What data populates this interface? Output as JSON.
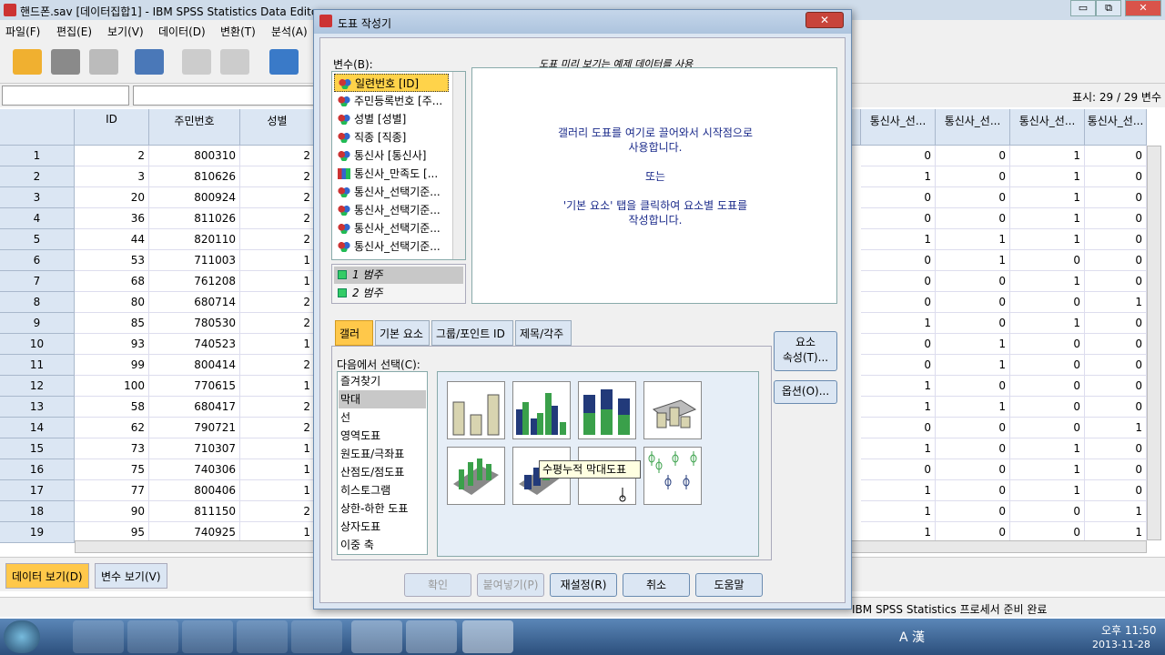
{
  "window": {
    "title": "핸드폰.sav [데이터집합1] - IBM SPSS Statistics Data Editor",
    "min": "▭",
    "restore": "⧉",
    "close": "✕"
  },
  "menu": [
    "파일(F)",
    "편집(E)",
    "보기(V)",
    "데이터(D)",
    "변환(T)",
    "분석(A)"
  ],
  "cellbar": {
    "show_count": "표시: 29 / 29 변수"
  },
  "grid": {
    "left_headers": [
      "ID",
      "주민번호",
      "성별"
    ],
    "right_headers": [
      "통신사_선...",
      "통신사_선...",
      "통신사_선...",
      "통신사_선..."
    ],
    "rows": [
      {
        "n": "1",
        "id": "2",
        "jumin": "800310",
        "sex": "2",
        "r": [
          "0",
          "0",
          "1",
          "0"
        ]
      },
      {
        "n": "2",
        "id": "3",
        "jumin": "810626",
        "sex": "2",
        "r": [
          "1",
          "0",
          "1",
          "0"
        ]
      },
      {
        "n": "3",
        "id": "20",
        "jumin": "800924",
        "sex": "2",
        "r": [
          "0",
          "0",
          "1",
          "0"
        ]
      },
      {
        "n": "4",
        "id": "36",
        "jumin": "811026",
        "sex": "2",
        "r": [
          "0",
          "0",
          "1",
          "0"
        ]
      },
      {
        "n": "5",
        "id": "44",
        "jumin": "820110",
        "sex": "2",
        "r": [
          "1",
          "1",
          "1",
          "0"
        ]
      },
      {
        "n": "6",
        "id": "53",
        "jumin": "711003",
        "sex": "1",
        "r": [
          "0",
          "1",
          "0",
          "0"
        ]
      },
      {
        "n": "7",
        "id": "68",
        "jumin": "761208",
        "sex": "1",
        "r": [
          "0",
          "0",
          "1",
          "0"
        ]
      },
      {
        "n": "8",
        "id": "80",
        "jumin": "680714",
        "sex": "2",
        "r": [
          "0",
          "0",
          "0",
          "1"
        ]
      },
      {
        "n": "9",
        "id": "85",
        "jumin": "780530",
        "sex": "2",
        "r": [
          "1",
          "0",
          "1",
          "0"
        ]
      },
      {
        "n": "10",
        "id": "93",
        "jumin": "740523",
        "sex": "1",
        "r": [
          "0",
          "1",
          "0",
          "0"
        ]
      },
      {
        "n": "11",
        "id": "99",
        "jumin": "800414",
        "sex": "2",
        "r": [
          "0",
          "1",
          "0",
          "0"
        ]
      },
      {
        "n": "12",
        "id": "100",
        "jumin": "770615",
        "sex": "1",
        "r": [
          "1",
          "0",
          "0",
          "0"
        ]
      },
      {
        "n": "13",
        "id": "58",
        "jumin": "680417",
        "sex": "2",
        "r": [
          "1",
          "1",
          "0",
          "0"
        ]
      },
      {
        "n": "14",
        "id": "62",
        "jumin": "790721",
        "sex": "2",
        "r": [
          "0",
          "0",
          "0",
          "1"
        ]
      },
      {
        "n": "15",
        "id": "73",
        "jumin": "710307",
        "sex": "1",
        "r": [
          "1",
          "0",
          "1",
          "0"
        ]
      },
      {
        "n": "16",
        "id": "75",
        "jumin": "740306",
        "sex": "1",
        "r": [
          "0",
          "0",
          "1",
          "0"
        ]
      },
      {
        "n": "17",
        "id": "77",
        "jumin": "800406",
        "sex": "1",
        "r": [
          "1",
          "0",
          "1",
          "0"
        ]
      },
      {
        "n": "18",
        "id": "90",
        "jumin": "811150",
        "sex": "2",
        "r": [
          "1",
          "0",
          "0",
          "1"
        ]
      },
      {
        "n": "19",
        "id": "95",
        "jumin": "740925",
        "sex": "1",
        "r": [
          "1",
          "0",
          "0",
          "1"
        ]
      }
    ]
  },
  "viewtabs": {
    "data": "데이터 보기(D)",
    "variable": "변수 보기(V)"
  },
  "status": "IBM SPSS Statistics 프로세서 준비 완료",
  "dialog": {
    "title": "도표 작성기",
    "variables_label": "변수(B):",
    "variables": [
      "일련번호 [ID]",
      "주민등록번호 [주...",
      "성별 [성별]",
      "직종 [직종]",
      "통신사 [통신사]",
      "통신사_만족도 [...",
      "통신사_선택기준...",
      "통신사_선택기준...",
      "통신사_선택기준...",
      "통신사_선택기준..."
    ],
    "categories": [
      "1 범주",
      "2 범주"
    ],
    "preview_label": "도표 미리 보기는 예제 데이터를 사용",
    "preview_msg1": "갤러리 도표를 여기로 끌어와서 시작점으로",
    "preview_msg2": "사용합니다.",
    "preview_or": "또는",
    "preview_msg3": "'기본 요소' 탭을 클릭하여 요소별 도표를",
    "preview_msg4": "작성합니다.",
    "tabs": [
      "갤러리",
      "기본 요소",
      "그룹/포인트 ID",
      "제목/각주"
    ],
    "select_label": "다음에서 선택(C):",
    "chart_types": [
      "즐겨찾기",
      "막대",
      "선",
      "영역도표",
      "원도표/극좌표",
      "산점도/점도표",
      "히스토그램",
      "상한-하한 도표",
      "상자도표",
      "이중 축"
    ],
    "tooltip": "수평누적 막대도표",
    "side_buttons": {
      "elem_line1": "요소",
      "elem_line2": "속성(T)...",
      "options": "옵션(O)..."
    },
    "buttons": {
      "ok": "확인",
      "paste": "붙여넣기(P)",
      "reset": "재설정(R)",
      "cancel": "취소",
      "help": "도움말"
    }
  },
  "tray": {
    "lang": "A 漢",
    "time": "오후 11:50",
    "date": "2013-11-28"
  }
}
